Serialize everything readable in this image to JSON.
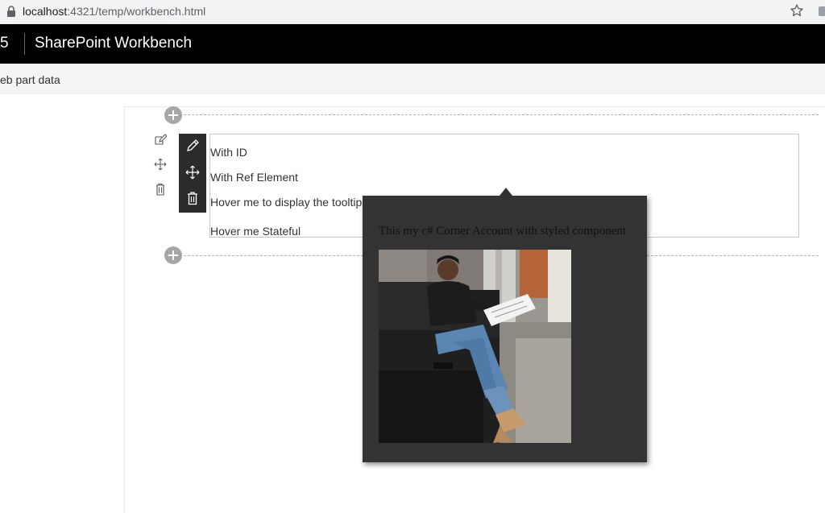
{
  "browser": {
    "url_host": "localhost",
    "url_path": ":4321/temp/workbench.html",
    "lock_icon": "lock-icon",
    "bookmark_icon": "star-icon"
  },
  "suitebar": {
    "app_fragment": "5",
    "title": "SharePoint Workbench"
  },
  "command_bar": {
    "item_label": "eb part data"
  },
  "webpart": {
    "lines": [
      "With ID",
      "With Ref Element",
      "Hover me to display the tooltip",
      "Hover me Stateful"
    ]
  },
  "section_toolbar": {
    "icons": [
      "edit-icon",
      "move-icon",
      "delete-icon"
    ]
  },
  "webpart_toolbar": {
    "icons": [
      "edit-icon",
      "move-icon",
      "delete-icon"
    ]
  },
  "tooltip": {
    "text": "This my c# Corner Account with styled component",
    "image_alt": "profile-photo"
  },
  "colors": {
    "suitebar_bg": "#000000",
    "command_bar_bg": "#f4f4f4",
    "tooltip_bg": "#333333",
    "toolbar_bg": "#2b2b2b"
  }
}
